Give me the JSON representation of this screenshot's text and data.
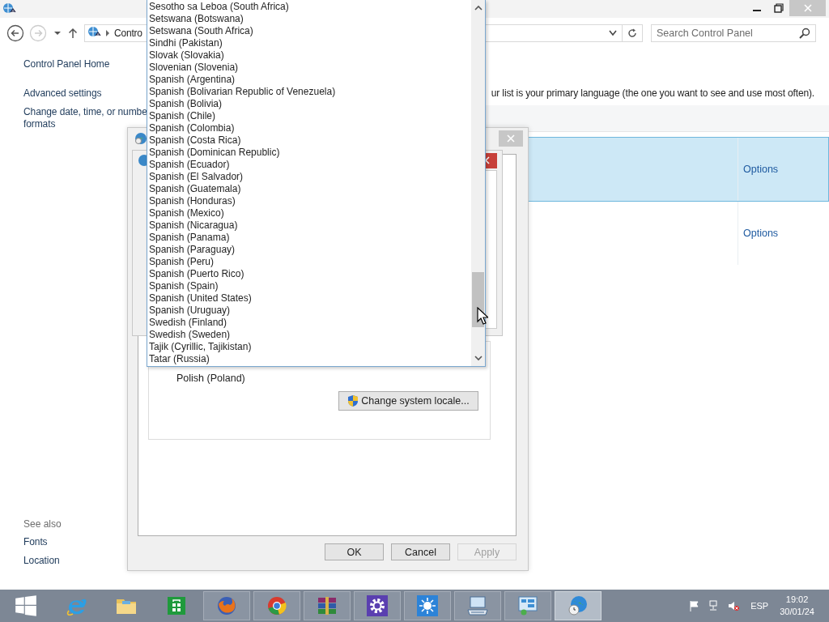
{
  "address_bar": {
    "breadcrumb": "Contro"
  },
  "search": {
    "placeholder": "Search Control Panel"
  },
  "sidebar": {
    "items": [
      {
        "lines": [
          "Control Panel Home"
        ]
      },
      {
        "lines": [
          "Advanced settings"
        ]
      },
      {
        "lines": [
          "Change date, time, or numbe",
          "formats"
        ]
      }
    ],
    "see_also": {
      "heading": "See also",
      "items": [
        "Fonts",
        "Location"
      ]
    }
  },
  "intro": "ur list is your primary language (the one you want to see and use most often).",
  "languages": [
    {
      "selected": true,
      "options": "Options"
    },
    {
      "selected": false,
      "options": "Options"
    }
  ],
  "dialog": {
    "locale": "Polish (Poland)",
    "change_locale_button": "Change system locale...",
    "buttons": [
      {
        "label": "OK",
        "disabled": false
      },
      {
        "label": "Cancel",
        "disabled": false
      },
      {
        "label": "Apply",
        "disabled": true
      }
    ]
  },
  "dropdown": {
    "items": [
      "Sesotho sa Leboa (South Africa)",
      "Setswana (Botswana)",
      "Setswana (South Africa)",
      "Sindhi (Pakistan)",
      "Slovak (Slovakia)",
      "Slovenian (Slovenia)",
      "Spanish (Argentina)",
      "Spanish (Bolivarian Republic of Venezuela)",
      "Spanish (Bolivia)",
      "Spanish (Chile)",
      "Spanish (Colombia)",
      "Spanish (Costa Rica)",
      "Spanish (Dominican Republic)",
      "Spanish (Ecuador)",
      "Spanish (El Salvador)",
      "Spanish (Guatemala)",
      "Spanish (Honduras)",
      "Spanish (Mexico)",
      "Spanish (Nicaragua)",
      "Spanish (Panama)",
      "Spanish (Paraguay)",
      "Spanish (Peru)",
      "Spanish (Puerto Rico)",
      "Spanish (Spain)",
      "Spanish (United States)",
      "Spanish (Uruguay)",
      "Swedish (Finland)",
      "Swedish (Sweden)",
      "Tajik (Cyrillic, Tajikistan)",
      "Tatar (Russia)"
    ]
  },
  "taskbar": {
    "apps": [
      {
        "kind": "ie",
        "running": false,
        "active": false
      },
      {
        "kind": "explorer",
        "running": false,
        "active": false
      },
      {
        "kind": "store",
        "running": false,
        "active": false
      },
      {
        "kind": "firefox",
        "running": true,
        "active": false
      },
      {
        "kind": "chrome",
        "running": true,
        "active": false
      },
      {
        "kind": "winrar",
        "running": true,
        "active": false
      },
      {
        "kind": "gear",
        "running": true,
        "active": false
      },
      {
        "kind": "sun",
        "running": true,
        "active": false
      },
      {
        "kind": "keyboard",
        "running": true,
        "active": false
      },
      {
        "kind": "panel",
        "running": true,
        "active": false
      },
      {
        "kind": "globe",
        "running": true,
        "active": true
      }
    ],
    "language": "ESP",
    "time": "19:02",
    "date": "30/01/24"
  }
}
